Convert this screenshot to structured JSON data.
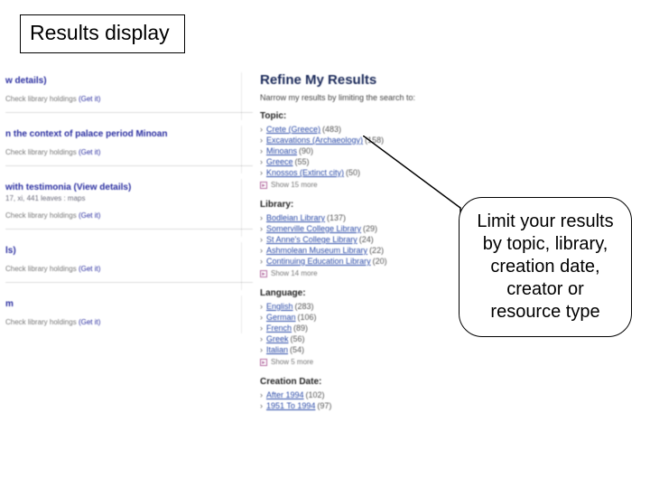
{
  "title_box": "Results display",
  "callout_text": "Limit your results by topic, library, creation date, creator or resource type",
  "results": [
    {
      "title_suffix": "w details)",
      "meta": "",
      "holdings_prefix": "Check library holdings",
      "holdings_link": "(Get it)"
    },
    {
      "title_suffix": "n the context of palace period Minoan",
      "meta": "",
      "holdings_prefix": "Check library holdings",
      "holdings_link": "(Get it)"
    },
    {
      "title_suffix": "with testimonia (View details)",
      "meta": "17, xi, 441 leaves : maps",
      "holdings_prefix": "Check library holdings",
      "holdings_link": "(Get it)"
    },
    {
      "title_suffix": "ls)",
      "meta": "",
      "holdings_prefix": "Check library holdings",
      "holdings_link": "(Get it)"
    },
    {
      "title_suffix": "m",
      "meta": "",
      "holdings_prefix": "Check library holdings",
      "holdings_link": "(Get it)"
    }
  ],
  "refine": {
    "heading": "Refine My Results",
    "narrow": "Narrow my results by limiting the search to:",
    "facets": [
      {
        "title": "Topic:",
        "items": [
          {
            "label": "Crete (Greece)",
            "count": "(483)"
          },
          {
            "label": "Excavations (Archaeology)",
            "count": "(158)"
          },
          {
            "label": "Minoans",
            "count": "(90)"
          },
          {
            "label": "Greece",
            "count": "(55)"
          },
          {
            "label": "Knossos (Extinct city)",
            "count": "(50)"
          }
        ],
        "show_more": "Show 15 more"
      },
      {
        "title": "Library:",
        "items": [
          {
            "label": "Bodleian Library",
            "count": "(137)"
          },
          {
            "label": "Somerville College Library",
            "count": "(29)"
          },
          {
            "label": "St Anne's College Library",
            "count": "(24)"
          },
          {
            "label": "Ashmolean Museum Library",
            "count": "(22)"
          },
          {
            "label": "Continuing Education Library",
            "count": "(20)"
          }
        ],
        "show_more": "Show 14 more"
      },
      {
        "title": "Language:",
        "items": [
          {
            "label": "English",
            "count": "(283)"
          },
          {
            "label": "German",
            "count": "(106)"
          },
          {
            "label": "French",
            "count": "(89)"
          },
          {
            "label": "Greek",
            "count": "(56)"
          },
          {
            "label": "Italian",
            "count": "(54)"
          }
        ],
        "show_more": "Show 5 more"
      },
      {
        "title": "Creation Date:",
        "items": [
          {
            "label": "After 1994",
            "count": "(102)"
          },
          {
            "label": "1951 To 1994",
            "count": "(97)"
          }
        ],
        "show_more": ""
      }
    ]
  }
}
